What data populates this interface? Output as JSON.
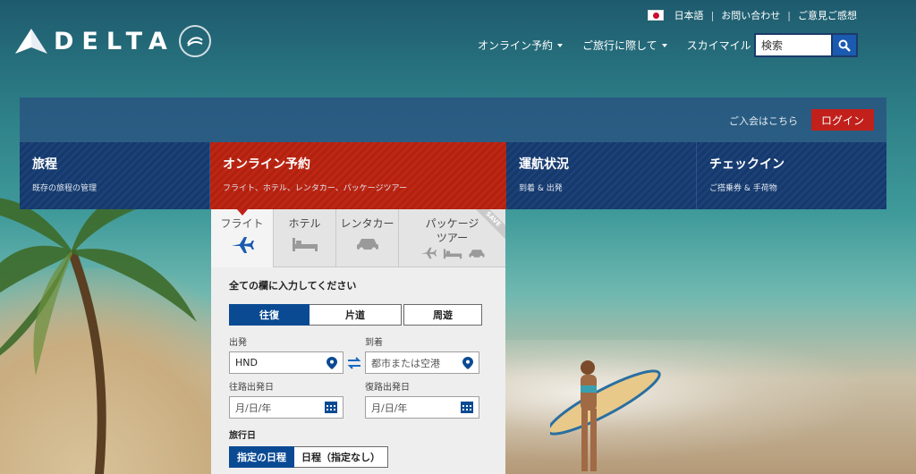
{
  "header": {
    "utility_links": [
      "日本語",
      "お問い合わせ",
      "ご意見ご感想"
    ],
    "logo_text": "DELTA",
    "nav": [
      {
        "label": "オンライン予約"
      },
      {
        "label": "ご旅行に際して"
      },
      {
        "label": "スカイマイル"
      }
    ],
    "search": {
      "placeholder": "検索"
    }
  },
  "member": {
    "join_label": "ご入会はこちら",
    "login_label": "ログイン"
  },
  "panels": [
    {
      "title": "旅程",
      "subtitle": "既存の旅程の管理"
    },
    {
      "title": "オンライン予約",
      "subtitle": "フライト、ホテル、レンタカー、パッケージツアー"
    },
    {
      "title": "運航状況",
      "subtitle": "到着 & 出発"
    },
    {
      "title": "チェックイン",
      "subtitle": "ご搭乗券 & 手荷物"
    }
  ],
  "booking": {
    "tabs": [
      "フライト",
      "ホテル",
      "レンタカー",
      "パッケージツアー"
    ],
    "package_tab_line1": "パッケージ",
    "package_tab_line2": "ツアー",
    "save_badge": "SAVE",
    "instruction": "全ての欄に入力してください",
    "trip_types": [
      "往復",
      "片道",
      "周遊"
    ],
    "origin": {
      "label": "出発",
      "value": "HND"
    },
    "destination": {
      "label": "到着",
      "placeholder": "都市または空港"
    },
    "depart_date": {
      "label": "往路出発日",
      "placeholder": "月/日/年"
    },
    "return_date": {
      "label": "復路出発日",
      "placeholder": "月/日/年"
    },
    "travel_dates": {
      "label": "旅行日",
      "options": [
        "指定の日程",
        "日程（指定なし）"
      ]
    }
  },
  "colors": {
    "accent_red": "#c1201b",
    "navy": "#16386b",
    "active_blue": "#0a4a93"
  }
}
